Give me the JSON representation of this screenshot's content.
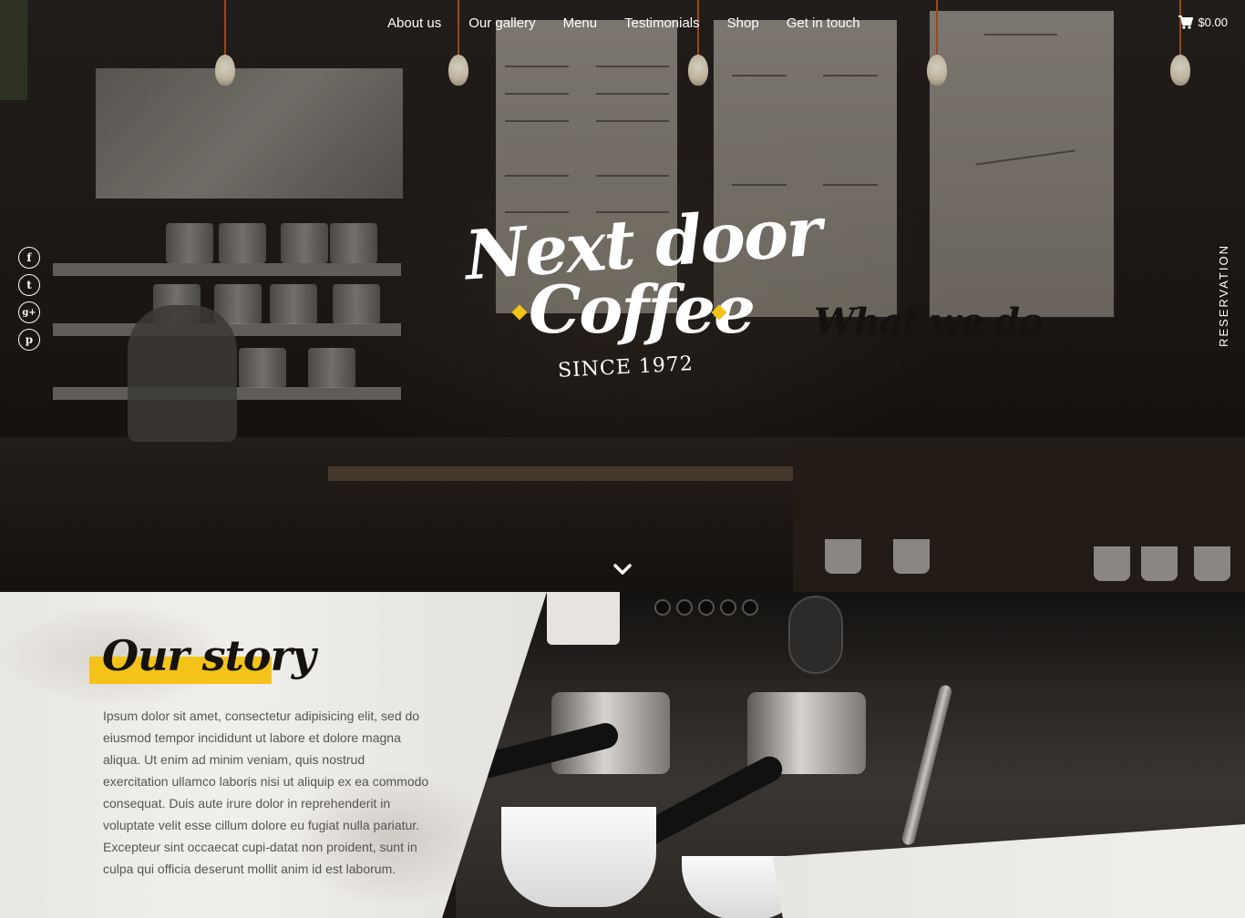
{
  "nav": {
    "items": [
      "About us",
      "Our gallery",
      "Menu",
      "Testimonials",
      "Shop",
      "Get in touch"
    ]
  },
  "cart": {
    "amount": "$0.00",
    "icon": "cart-icon"
  },
  "social": {
    "icons": [
      "facebook-icon",
      "twitter-icon",
      "google-plus-icon",
      "pinterest-icon"
    ],
    "glyphs": [
      "f",
      "t",
      "g+",
      "p"
    ]
  },
  "reservation": {
    "label": "RESERVATION"
  },
  "logo": {
    "line1": "Next door",
    "line2": "Coffee",
    "since": "SINCE 1972"
  },
  "hero": {
    "scroll_icon": "chevron-down-icon"
  },
  "story": {
    "title": "Our story",
    "text": "Ipsum dolor sit amet, consectetur adipisicing elit, sed do eiusmod tempor incididunt ut labore et dolore magna aliqua. Ut enim ad minim veniam, quis nostrud exercitation ullamco laboris nisi ut aliquip ex ea commodo consequat. Duis aute irure dolor in reprehenderit in voluptate velit esse cillum dolore eu fugiat nulla pariatur. Excepteur sint occaecat cupi-datat non proident, sunt in culpa qui officia deserunt mollit anim id est laborum."
  },
  "what": {
    "title": "What we do"
  },
  "colors": {
    "accent": "#f3c319",
    "dark": "#151210"
  }
}
